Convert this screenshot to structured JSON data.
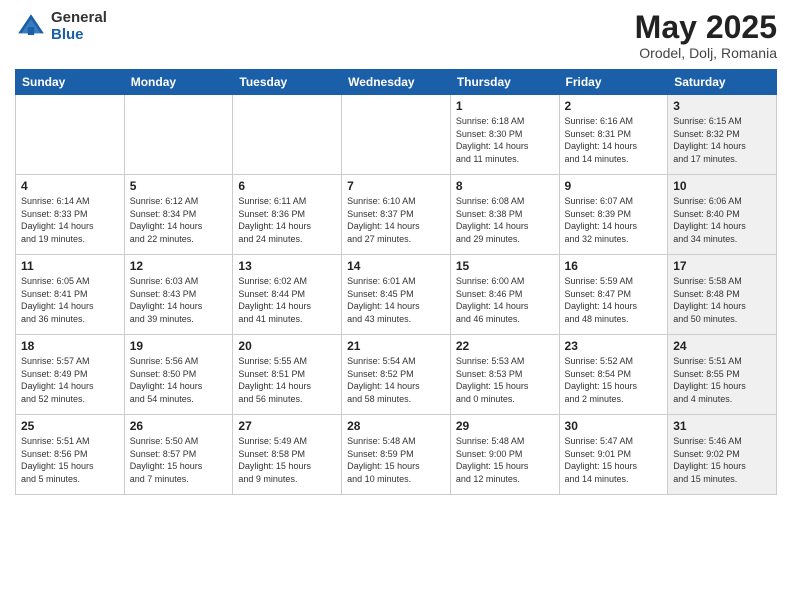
{
  "header": {
    "logo_general": "General",
    "logo_blue": "Blue",
    "month_title": "May 2025",
    "location": "Orodel, Dolj, Romania"
  },
  "days_of_week": [
    "Sunday",
    "Monday",
    "Tuesday",
    "Wednesday",
    "Thursday",
    "Friday",
    "Saturday"
  ],
  "weeks": [
    [
      {
        "day": "",
        "info": "",
        "shaded": false
      },
      {
        "day": "",
        "info": "",
        "shaded": false
      },
      {
        "day": "",
        "info": "",
        "shaded": false
      },
      {
        "day": "",
        "info": "",
        "shaded": false
      },
      {
        "day": "1",
        "info": "Sunrise: 6:18 AM\nSunset: 8:30 PM\nDaylight: 14 hours\nand 11 minutes.",
        "shaded": false
      },
      {
        "day": "2",
        "info": "Sunrise: 6:16 AM\nSunset: 8:31 PM\nDaylight: 14 hours\nand 14 minutes.",
        "shaded": false
      },
      {
        "day": "3",
        "info": "Sunrise: 6:15 AM\nSunset: 8:32 PM\nDaylight: 14 hours\nand 17 minutes.",
        "shaded": true
      }
    ],
    [
      {
        "day": "4",
        "info": "Sunrise: 6:14 AM\nSunset: 8:33 PM\nDaylight: 14 hours\nand 19 minutes.",
        "shaded": false
      },
      {
        "day": "5",
        "info": "Sunrise: 6:12 AM\nSunset: 8:34 PM\nDaylight: 14 hours\nand 22 minutes.",
        "shaded": false
      },
      {
        "day": "6",
        "info": "Sunrise: 6:11 AM\nSunset: 8:36 PM\nDaylight: 14 hours\nand 24 minutes.",
        "shaded": false
      },
      {
        "day": "7",
        "info": "Sunrise: 6:10 AM\nSunset: 8:37 PM\nDaylight: 14 hours\nand 27 minutes.",
        "shaded": false
      },
      {
        "day": "8",
        "info": "Sunrise: 6:08 AM\nSunset: 8:38 PM\nDaylight: 14 hours\nand 29 minutes.",
        "shaded": false
      },
      {
        "day": "9",
        "info": "Sunrise: 6:07 AM\nSunset: 8:39 PM\nDaylight: 14 hours\nand 32 minutes.",
        "shaded": false
      },
      {
        "day": "10",
        "info": "Sunrise: 6:06 AM\nSunset: 8:40 PM\nDaylight: 14 hours\nand 34 minutes.",
        "shaded": true
      }
    ],
    [
      {
        "day": "11",
        "info": "Sunrise: 6:05 AM\nSunset: 8:41 PM\nDaylight: 14 hours\nand 36 minutes.",
        "shaded": false
      },
      {
        "day": "12",
        "info": "Sunrise: 6:03 AM\nSunset: 8:43 PM\nDaylight: 14 hours\nand 39 minutes.",
        "shaded": false
      },
      {
        "day": "13",
        "info": "Sunrise: 6:02 AM\nSunset: 8:44 PM\nDaylight: 14 hours\nand 41 minutes.",
        "shaded": false
      },
      {
        "day": "14",
        "info": "Sunrise: 6:01 AM\nSunset: 8:45 PM\nDaylight: 14 hours\nand 43 minutes.",
        "shaded": false
      },
      {
        "day": "15",
        "info": "Sunrise: 6:00 AM\nSunset: 8:46 PM\nDaylight: 14 hours\nand 46 minutes.",
        "shaded": false
      },
      {
        "day": "16",
        "info": "Sunrise: 5:59 AM\nSunset: 8:47 PM\nDaylight: 14 hours\nand 48 minutes.",
        "shaded": false
      },
      {
        "day": "17",
        "info": "Sunrise: 5:58 AM\nSunset: 8:48 PM\nDaylight: 14 hours\nand 50 minutes.",
        "shaded": true
      }
    ],
    [
      {
        "day": "18",
        "info": "Sunrise: 5:57 AM\nSunset: 8:49 PM\nDaylight: 14 hours\nand 52 minutes.",
        "shaded": false
      },
      {
        "day": "19",
        "info": "Sunrise: 5:56 AM\nSunset: 8:50 PM\nDaylight: 14 hours\nand 54 minutes.",
        "shaded": false
      },
      {
        "day": "20",
        "info": "Sunrise: 5:55 AM\nSunset: 8:51 PM\nDaylight: 14 hours\nand 56 minutes.",
        "shaded": false
      },
      {
        "day": "21",
        "info": "Sunrise: 5:54 AM\nSunset: 8:52 PM\nDaylight: 14 hours\nand 58 minutes.",
        "shaded": false
      },
      {
        "day": "22",
        "info": "Sunrise: 5:53 AM\nSunset: 8:53 PM\nDaylight: 15 hours\nand 0 minutes.",
        "shaded": false
      },
      {
        "day": "23",
        "info": "Sunrise: 5:52 AM\nSunset: 8:54 PM\nDaylight: 15 hours\nand 2 minutes.",
        "shaded": false
      },
      {
        "day": "24",
        "info": "Sunrise: 5:51 AM\nSunset: 8:55 PM\nDaylight: 15 hours\nand 4 minutes.",
        "shaded": true
      }
    ],
    [
      {
        "day": "25",
        "info": "Sunrise: 5:51 AM\nSunset: 8:56 PM\nDaylight: 15 hours\nand 5 minutes.",
        "shaded": false
      },
      {
        "day": "26",
        "info": "Sunrise: 5:50 AM\nSunset: 8:57 PM\nDaylight: 15 hours\nand 7 minutes.",
        "shaded": false
      },
      {
        "day": "27",
        "info": "Sunrise: 5:49 AM\nSunset: 8:58 PM\nDaylight: 15 hours\nand 9 minutes.",
        "shaded": false
      },
      {
        "day": "28",
        "info": "Sunrise: 5:48 AM\nSunset: 8:59 PM\nDaylight: 15 hours\nand 10 minutes.",
        "shaded": false
      },
      {
        "day": "29",
        "info": "Sunrise: 5:48 AM\nSunset: 9:00 PM\nDaylight: 15 hours\nand 12 minutes.",
        "shaded": false
      },
      {
        "day": "30",
        "info": "Sunrise: 5:47 AM\nSunset: 9:01 PM\nDaylight: 15 hours\nand 14 minutes.",
        "shaded": false
      },
      {
        "day": "31",
        "info": "Sunrise: 5:46 AM\nSunset: 9:02 PM\nDaylight: 15 hours\nand 15 minutes.",
        "shaded": true
      }
    ]
  ]
}
